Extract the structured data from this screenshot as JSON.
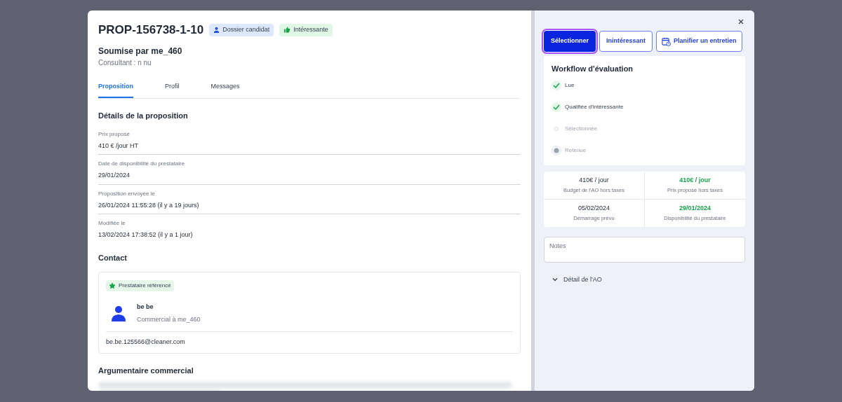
{
  "header": {
    "title": "PROP-156738-1-10",
    "badges": [
      {
        "label": "Dossier candidat",
        "kind": "person"
      },
      {
        "label": "Intéressante",
        "kind": "thumb"
      }
    ],
    "submitted_by": "Soumise par me_460",
    "consultant": "Consultant : n nu"
  },
  "tabs": [
    {
      "label": "Proposition",
      "selected": true
    },
    {
      "label": "Profil",
      "selected": false
    },
    {
      "label": "Messages",
      "selected": false
    }
  ],
  "details": {
    "title": "Détails de la proposition",
    "fields": [
      {
        "label": "Prix proposé",
        "value": "410 € /jour HT"
      },
      {
        "label": "Date de disponibilité du prestataire",
        "value": "29/01/2024"
      },
      {
        "label": "Proposition envoyée le",
        "value": "26/01/2024 11:55:28 (il y a 19 jours)"
      },
      {
        "label": "Modifiée le",
        "value": "13/02/2024 17:38:52 (il y a 1 jour)"
      }
    ]
  },
  "contact": {
    "title": "Contact",
    "badge": "Prestataire référencé",
    "name": "be be",
    "role": "Commercial à me_460",
    "email": "be.be.125566@cleaner.com"
  },
  "argumentaire": {
    "title": "Argumentaire commercial"
  },
  "actions": [
    {
      "label": "Sélectionner",
      "kind": "primary"
    },
    {
      "label": "Inintéressant",
      "kind": "outline"
    },
    {
      "label": "Planifier un entretien",
      "kind": "calendar"
    }
  ],
  "workflow": {
    "title": "Workflow d'évaluation",
    "steps": [
      {
        "label": "Lue",
        "done": true
      },
      {
        "label": "Qualifiée d'intéressante",
        "done": true
      },
      {
        "label": "Sélectionnée",
        "done": false,
        "kind": "dot"
      },
      {
        "label": "Retenue",
        "done": false,
        "kind": "disc"
      }
    ]
  },
  "stats": [
    {
      "value": "410€ / jour",
      "label": "Budget de l'AO hors taxes",
      "highlight": false
    },
    {
      "value": "410€ / jour",
      "label": "Prix proposé hors taxes",
      "highlight": true
    },
    {
      "value": "05/02/2024",
      "label": "Démarrage prévu",
      "highlight": false
    },
    {
      "value": "29/01/2024",
      "label": "Disponibilité du prestataire",
      "highlight": true
    }
  ],
  "notes": {
    "placeholder": "Notes"
  },
  "ao_detail": {
    "label": "Détail de l'AO",
    "expanded": false
  }
}
